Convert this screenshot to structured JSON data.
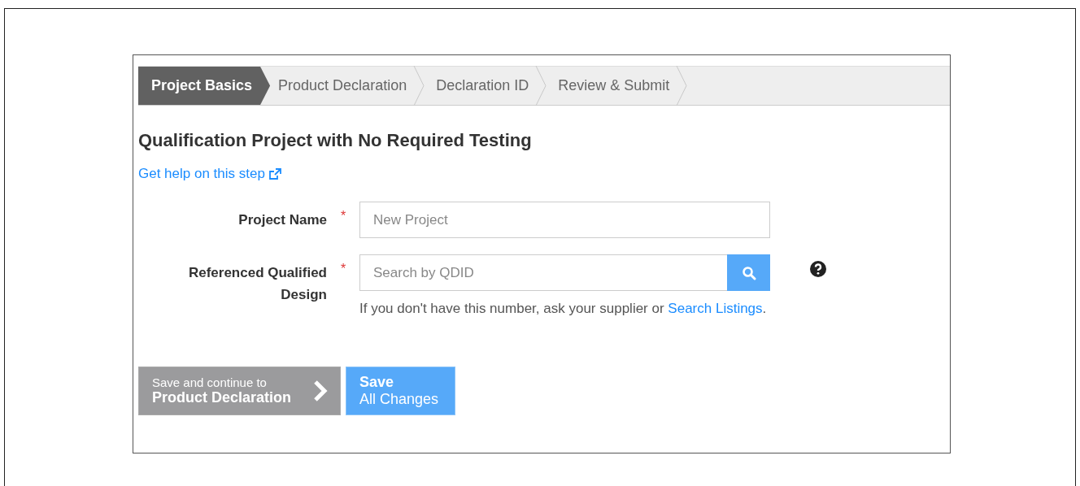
{
  "steps": [
    {
      "label": "Project Basics",
      "selected": true
    },
    {
      "label": "Product Declaration",
      "selected": false
    },
    {
      "label": "Declaration ID",
      "selected": false
    },
    {
      "label": "Review & Submit",
      "selected": false
    }
  ],
  "heading": "Qualification Project with No Required Testing",
  "help_link": "Get help on this step",
  "fields": [
    {
      "kind": "text",
      "label": "Project Name",
      "required": true,
      "placeholder": "New Project"
    },
    {
      "kind": "search",
      "label": "Referenced Qualified Design",
      "required": true,
      "placeholder": "Search by QDID",
      "hint": "If you don't have this number, ask your supplier or",
      "hint_link": "Search Listings",
      "hint_end": "."
    }
  ],
  "required_mark": "*",
  "continue_button": {
    "line_1": "Save and continue to",
    "line_2": "Product Declaration"
  },
  "save_button": {
    "line_1": "Save",
    "line_2": "All Changes"
  }
}
